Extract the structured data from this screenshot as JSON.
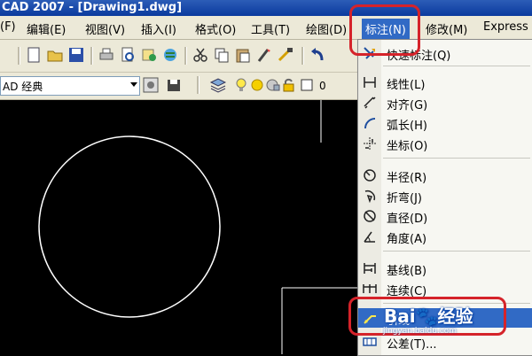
{
  "window": {
    "title": "CAD 2007 - [Drawing1.dwg]"
  },
  "menubar": {
    "items": [
      "(F)",
      "编辑(E)",
      "视图(V)",
      "插入(I)",
      "格式(O)",
      "工具(T)",
      "绘图(D)",
      "标注(N)",
      "修改(M)",
      "Express"
    ]
  },
  "toolbar": {
    "workspace": "AD 经典",
    "layer": "0"
  },
  "dimension_menu": {
    "items": [
      {
        "label": "快速标注(Q)",
        "icon": "quick-dimension-icon"
      },
      {
        "label": "线性(L)",
        "icon": "linear-icon"
      },
      {
        "label": "对齐(G)",
        "icon": "aligned-icon"
      },
      {
        "label": "弧长(H)",
        "icon": "arc-length-icon"
      },
      {
        "label": "坐标(O)",
        "icon": "ordinate-icon"
      },
      {
        "label": "半径(R)",
        "icon": "radius-icon"
      },
      {
        "label": "折弯(J)",
        "icon": "jogged-icon"
      },
      {
        "label": "直径(D)",
        "icon": "diameter-icon"
      },
      {
        "label": "角度(A)",
        "icon": "angular-icon"
      },
      {
        "label": "基线(B)",
        "icon": "baseline-icon"
      },
      {
        "label": "连续(C)",
        "icon": "continue-icon"
      },
      {
        "label": "引线",
        "icon": "leader-icon"
      },
      {
        "label": "公差(T)...",
        "icon": "tolerance-icon"
      }
    ]
  },
  "watermark": {
    "brand": "Bai",
    "brand_suffix": "经验",
    "url": "jingyan.baidu.com"
  },
  "colors": {
    "highlight": "#316ac5",
    "annotation_red": "#d5232a",
    "canvas": "#000000"
  }
}
